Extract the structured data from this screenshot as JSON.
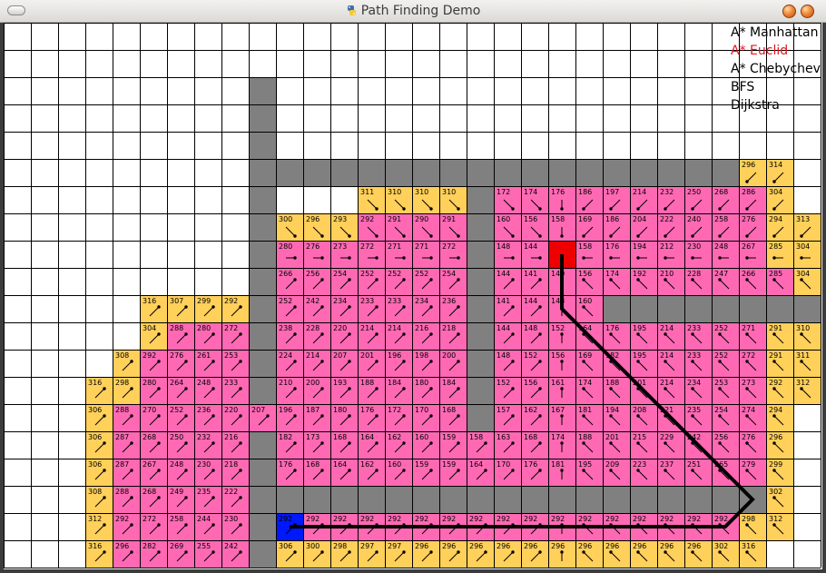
{
  "window": {
    "title": "Path Finding Demo",
    "icon": "python-icon"
  },
  "menu": {
    "items": [
      {
        "label": "A* Manhattan",
        "color": "#000000"
      },
      {
        "label": "A* Euclid",
        "color": "#e8141e"
      },
      {
        "label": "A* Chebychev",
        "color": "#000000"
      },
      {
        "label": "BFS",
        "color": "#000000"
      },
      {
        "label": "Dijkstra",
        "color": "#000000"
      }
    ]
  },
  "colors": {
    "wall": "#808080",
    "closed": "#ff69b4",
    "open": "#ffd05a",
    "empty": "#ffffff",
    "start": "#0018ff",
    "goal": "#ee0000",
    "grid_line": "#000000",
    "path": "#000000"
  },
  "grid": {
    "cols": 30,
    "rows": 20,
    "legend": "W=wall, P=visited(pink), O=frontier(orange), S=start, G=goal, .=empty",
    "map": [
      "..............................",
      "..............................",
      ".........W....................",
      ".........W....................",
      ".........W....................",
      ".........WWWWWWWWWWWWWWWWWWOO.",
      ".........W...OOOOWPPPPPPPPPPO.",
      ".........WOOOPPPPWPPPPPPPPPPOO",
      ".........WPPPPPPPWPPGPPPPPPPOO",
      ".........WPPPPPPPWPPPPPPPPPPPO",
      ".....OOOOWPPPPPPPWPPPPWWWWWWWW",
      ".....OPPPWPPPPPPPWPPPPPPPPPPOO",
      "....OPPPPWPPPPPPPWPPPPPPPPPPOO",
      "...OOPPPPWPPPPPPPWPPPPPPPPPPOO",
      "...OPPPPPPPPPPPPPWPPPPPPPPPPO.",
      "...OPPPPPWPPPPPPPPPPPPPPPPPPO.",
      "...OPPPPPWPPPPPPPPPPPPPPPPPPO.",
      "...OPPPPPWWWWWWWWWWWWWWWWWWWO.",
      "...OPPPPPWSPPPPPPPPPPPPPPPPOO.",
      "...OPPPPPWOOOOOOOOOOOOOOOOOO.."
    ],
    "costs": {
      "5": {
        "27": "296",
        "28": "314"
      },
      "6": {
        "13": "311",
        "14": "310",
        "15": "310",
        "16": "310",
        "18": "172",
        "19": "174",
        "20": "176",
        "21": "186",
        "22": "197",
        "23": "214",
        "24": "232",
        "25": "250",
        "26": "268",
        "27": "286",
        "28": "304"
      },
      "7": {
        "10": "300",
        "11": "296",
        "12": "293",
        "13": "292",
        "14": "291",
        "15": "290",
        "16": "291",
        "18": "160",
        "19": "156",
        "20": "158",
        "21": "169",
        "22": "186",
        "23": "204",
        "24": "222",
        "25": "240",
        "26": "258",
        "27": "276",
        "28": "294",
        "29": "313"
      },
      "8": {
        "10": "280",
        "11": "276",
        "12": "273",
        "13": "272",
        "14": "271",
        "15": "271",
        "16": "272",
        "18": "148",
        "19": "144",
        "21": "158",
        "22": "176",
        "23": "194",
        "24": "212",
        "25": "230",
        "26": "248",
        "27": "267",
        "28": "285",
        "29": "304"
      },
      "9": {
        "10": "266",
        "11": "256",
        "12": "254",
        "13": "252",
        "14": "252",
        "15": "252",
        "16": "254",
        "18": "144",
        "19": "141",
        "20": "140",
        "21": "156",
        "22": "174",
        "23": "192",
        "24": "210",
        "25": "228",
        "26": "247",
        "27": "266",
        "28": "285",
        "29": "304"
      },
      "10": {
        "5": "316",
        "6": "307",
        "7": "299",
        "8": "292",
        "10": "252",
        "11": "242",
        "12": "234",
        "13": "233",
        "14": "233",
        "15": "234",
        "16": "236",
        "18": "141",
        "19": "144",
        "20": "148",
        "21": "160"
      },
      "11": {
        "5": "304",
        "6": "288",
        "7": "280",
        "8": "272",
        "10": "238",
        "11": "228",
        "12": "220",
        "13": "214",
        "14": "214",
        "15": "216",
        "16": "218",
        "18": "144",
        "19": "148",
        "20": "152",
        "21": "164",
        "22": "176",
        "23": "195",
        "24": "214",
        "25": "233",
        "26": "252",
        "27": "271",
        "28": "291",
        "29": "310"
      },
      "12": {
        "4": "308",
        "5": "292",
        "6": "276",
        "7": "261",
        "8": "253",
        "10": "224",
        "11": "214",
        "12": "207",
        "13": "201",
        "14": "196",
        "15": "198",
        "16": "200",
        "18": "148",
        "19": "152",
        "20": "156",
        "21": "169",
        "22": "182",
        "23": "195",
        "24": "214",
        "25": "233",
        "26": "252",
        "27": "272",
        "28": "291",
        "29": "311"
      },
      "13": {
        "3": "316",
        "4": "298",
        "5": "280",
        "6": "264",
        "7": "248",
        "8": "233",
        "10": "210",
        "11": "200",
        "12": "193",
        "13": "188",
        "14": "184",
        "15": "180",
        "16": "184",
        "18": "152",
        "19": "156",
        "20": "161",
        "21": "174",
        "22": "188",
        "23": "201",
        "24": "214",
        "25": "234",
        "26": "253",
        "27": "273",
        "28": "292",
        "29": "312"
      },
      "14": {
        "3": "306",
        "4": "288",
        "5": "270",
        "6": "252",
        "7": "236",
        "8": "220",
        "9": "207",
        "10": "196",
        "11": "187",
        "12": "180",
        "13": "176",
        "14": "172",
        "15": "170",
        "16": "168",
        "18": "157",
        "19": "162",
        "20": "167",
        "21": "181",
        "22": "194",
        "23": "208",
        "24": "221",
        "25": "235",
        "26": "254",
        "27": "274",
        "28": "294"
      },
      "15": {
        "3": "306",
        "4": "287",
        "5": "268",
        "6": "250",
        "7": "232",
        "8": "216",
        "10": "182",
        "11": "173",
        "12": "168",
        "13": "164",
        "14": "162",
        "15": "160",
        "16": "159",
        "17": "158",
        "18": "163",
        "19": "168",
        "20": "174",
        "21": "188",
        "22": "201",
        "23": "215",
        "24": "229",
        "25": "242",
        "26": "256",
        "27": "276",
        "28": "296"
      },
      "16": {
        "3": "306",
        "4": "287",
        "5": "267",
        "6": "248",
        "7": "230",
        "8": "218",
        "10": "176",
        "11": "168",
        "12": "164",
        "13": "162",
        "14": "160",
        "15": "159",
        "16": "159",
        "17": "164",
        "18": "170",
        "19": "176",
        "20": "181",
        "21": "195",
        "22": "209",
        "23": "223",
        "24": "237",
        "25": "251",
        "26": "265",
        "27": "279",
        "28": "299"
      },
      "17": {
        "3": "308",
        "4": "288",
        "5": "268",
        "6": "249",
        "7": "235",
        "8": "222",
        "28": "302"
      },
      "18": {
        "3": "312",
        "4": "292",
        "5": "272",
        "6": "258",
        "7": "244",
        "8": "230",
        "10": "292",
        "11": "292",
        "12": "292",
        "13": "292",
        "14": "292",
        "15": "292",
        "16": "292",
        "17": "292",
        "18": "292",
        "19": "292",
        "20": "292",
        "21": "292",
        "22": "292",
        "23": "292",
        "24": "292",
        "25": "292",
        "26": "292",
        "27": "298",
        "28": "312"
      },
      "19": {
        "3": "316",
        "4": "296",
        "5": "282",
        "6": "269",
        "7": "255",
        "8": "242",
        "10": "306",
        "11": "300",
        "12": "298",
        "13": "297",
        "14": "297",
        "15": "296",
        "16": "296",
        "17": "296",
        "18": "296",
        "19": "296",
        "20": "296",
        "21": "296",
        "22": "296",
        "23": "296",
        "24": "296",
        "25": "296",
        "26": "302",
        "27": "316"
      }
    },
    "path": [
      [
        10,
        18
      ],
      [
        26,
        18
      ],
      [
        27,
        17
      ],
      [
        20,
        10
      ],
      [
        20,
        8
      ]
    ]
  }
}
